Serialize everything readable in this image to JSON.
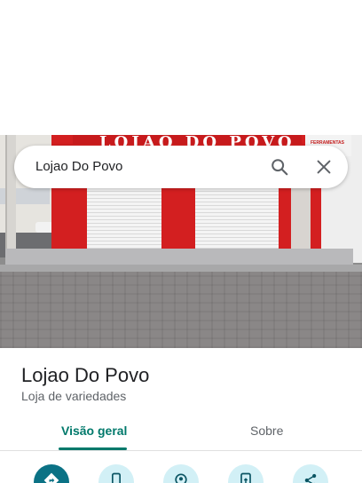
{
  "search": {
    "value": "Lojao Do Povo"
  },
  "photo": {
    "sign_text": "LOJÃO DO POVO",
    "side_sign_text": "FERRAMENTAS"
  },
  "place": {
    "name": "Lojao Do Povo",
    "category": "Loja de variedades"
  },
  "tabs": [
    {
      "label": "Visão geral",
      "active": true
    },
    {
      "label": "Sobre",
      "active": false
    }
  ],
  "actions": [
    {
      "icon": "directions-icon"
    },
    {
      "icon": "phone-icon"
    },
    {
      "icon": "save-place-icon"
    },
    {
      "icon": "send-to-phone-icon"
    },
    {
      "icon": "share-icon"
    }
  ],
  "colors": {
    "accent": "#00796b",
    "primary_action": "#0b7285",
    "action_bg": "#d2f0f6",
    "store_red": "#d31f20"
  }
}
